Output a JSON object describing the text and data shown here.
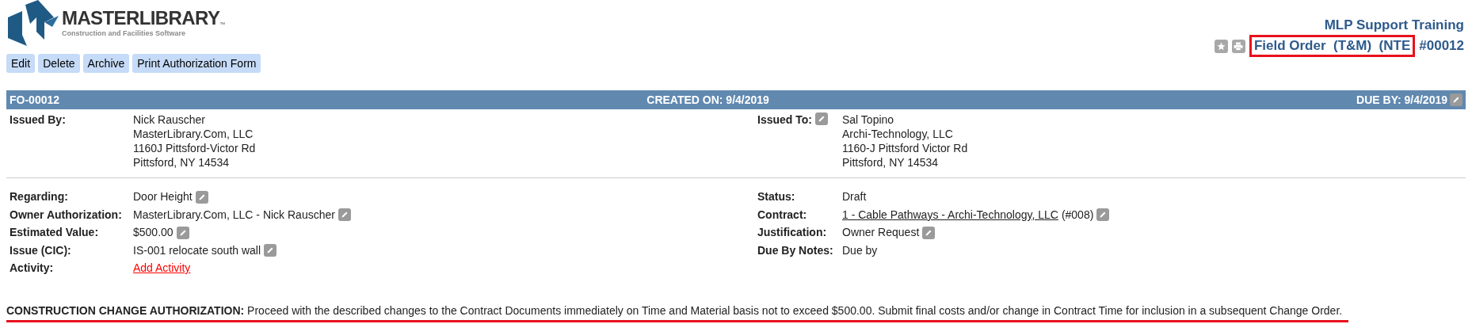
{
  "logo": {
    "name": "MASTERLIBRARY",
    "mark": "™",
    "tagline": "Construction and Facilities Software"
  },
  "actions": [
    "Edit",
    "Delete",
    "Archive",
    "Print Authorization Form"
  ],
  "project": "MLP Support Training",
  "document": {
    "title": "Field Order  (T&M)  (NTE",
    "number": "#00012",
    "highlighted": true
  },
  "header": {
    "id": "FO-00012",
    "created": "CREATED ON: 9/4/2019",
    "due": "DUE BY: 9/4/2019",
    "due_editable": true
  },
  "issued_by": {
    "label": "Issued By:",
    "editable": false,
    "lines": [
      "Nick Rauscher",
      "MasterLibrary.Com, LLC",
      "1160J Pittsford-Victor Rd",
      "Pittsford, NY 14534"
    ]
  },
  "issued_to": {
    "label": "Issued To:",
    "editable": true,
    "lines": [
      "Sal Topino",
      "Archi-Technology, LLC",
      "1160-J Pittsford Victor Rd",
      "Pittsford, NY 14534"
    ]
  },
  "left_fields": [
    {
      "label": "Regarding:",
      "kind": "text",
      "value": "Door Height",
      "editable": true
    },
    {
      "label": "Owner Authorization:",
      "kind": "text",
      "value": "MasterLibrary.Com, LLC - Nick Rauscher",
      "editable": true
    },
    {
      "label": "Estimated Value:",
      "kind": "text",
      "value": "$500.00",
      "editable": true
    },
    {
      "label": "Issue (CIC):",
      "kind": "text",
      "value": "IS-001 relocate south wall",
      "editable": true
    },
    {
      "label": "Activity:",
      "kind": "action",
      "value": "Add Activity",
      "editable": false
    }
  ],
  "right_fields": [
    {
      "label": "Status:",
      "kind": "text",
      "value": "Draft",
      "editable": false
    },
    {
      "label": "Contract:",
      "kind": "link",
      "value": "1 - Cable Pathways - Archi-Technology, LLC",
      "note": "(#008)",
      "editable": true
    },
    {
      "label": "Justification:",
      "kind": "text",
      "value": "Owner Request",
      "editable": true
    },
    {
      "label": "Due By Notes:",
      "kind": "text",
      "value": "Due by",
      "editable": false
    }
  ],
  "authorization": {
    "label": "CONSTRUCTION CHANGE AUTHORIZATION:",
    "text": "Proceed with the described changes to the Contract Documents immediately on Time and Material basis not to exceed $500.00. Submit final costs and/or change in Contract Time for inclusion in a subsequent Change Order.",
    "underlined": true
  }
}
